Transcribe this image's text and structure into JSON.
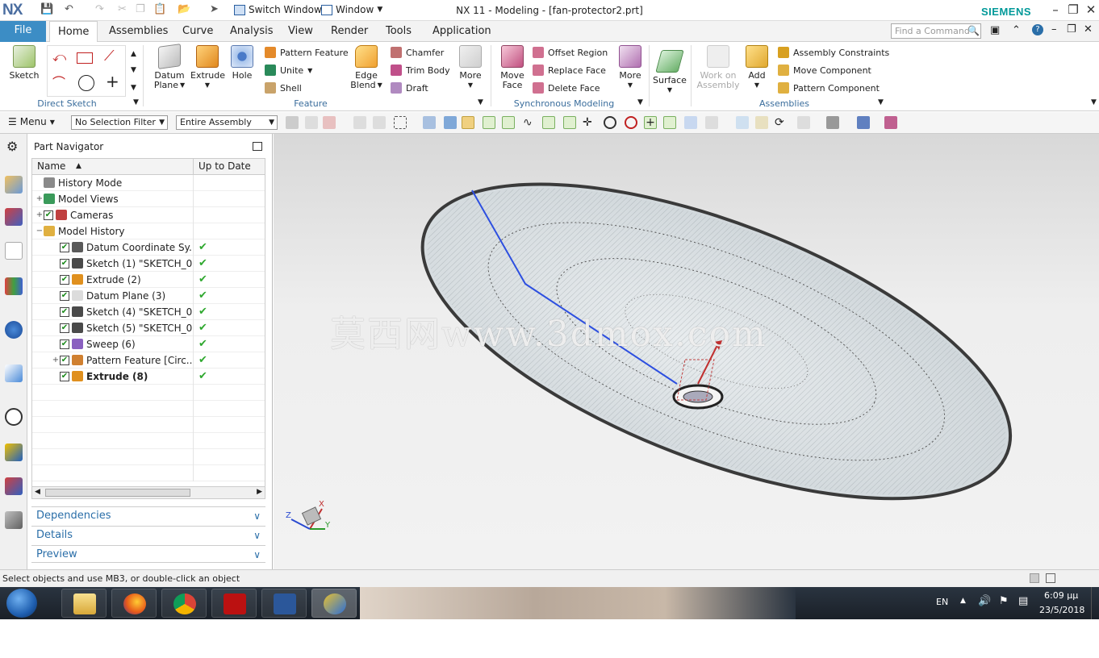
{
  "app": {
    "logo": "NX",
    "window_title": "NX 11 - Modeling - [fan-protector2.prt]",
    "brand": "SIEMENS",
    "switch_window": "Switch Window",
    "window_menu": "Window"
  },
  "tabs": {
    "file": "File",
    "items": [
      "Home",
      "Assemblies",
      "Curve",
      "Analysis",
      "View",
      "Render",
      "Tools",
      "Application"
    ],
    "active": "Home"
  },
  "find_command": {
    "placeholder": "Find a Command"
  },
  "ribbon": {
    "sketch": "Sketch",
    "direct_sketch_label": "Direct Sketch",
    "datum_plane": [
      "Datum",
      "Plane"
    ],
    "extrude": "Extrude",
    "hole": "Hole",
    "pattern_feature": "Pattern Feature",
    "unite": "Unite",
    "shell": "Shell",
    "edge_blend": [
      "Edge",
      "Blend"
    ],
    "chamfer": "Chamfer",
    "trim_body": "Trim Body",
    "draft": "Draft",
    "more1": "More",
    "feature_label": "Feature",
    "move_face": [
      "Move",
      "Face"
    ],
    "offset_region": "Offset Region",
    "replace_face": "Replace Face",
    "delete_face": "Delete Face",
    "more2": "More",
    "sync_label": "Synchronous Modeling",
    "surface": "Surface",
    "work_on_assembly": [
      "Work on",
      "Assembly"
    ],
    "add": "Add",
    "assembly_constraints": "Assembly Constraints",
    "move_component": "Move Component",
    "pattern_component": "Pattern Component",
    "assemblies_label": "Assemblies"
  },
  "toolbar": {
    "menu": "Menu",
    "selection_filter": "No Selection Filter",
    "scope": "Entire Assembly"
  },
  "navigator": {
    "title": "Part Navigator",
    "col_name": "Name",
    "col_uptodate": "Up to Date",
    "rows": [
      {
        "label": "History Mode",
        "level": 0,
        "expander": "",
        "check": false,
        "uptodate": false,
        "bold": false,
        "icon": "clock-icon"
      },
      {
        "label": "Model Views",
        "level": 0,
        "expander": "+",
        "check": false,
        "uptodate": false,
        "bold": false,
        "icon": "views-icon"
      },
      {
        "label": "Cameras",
        "level": 0,
        "expander": "+",
        "check": true,
        "uptodate": false,
        "bold": false,
        "icon": "camera-icon"
      },
      {
        "label": "Model History",
        "level": 0,
        "expander": "−",
        "check": false,
        "uptodate": false,
        "bold": false,
        "icon": "folder-icon"
      },
      {
        "label": "Datum Coordinate Sy...",
        "level": 1,
        "expander": "",
        "check": true,
        "uptodate": true,
        "bold": false,
        "icon": "csys-icon"
      },
      {
        "label": "Sketch (1) \"SKETCH_0...",
        "level": 1,
        "expander": "",
        "check": true,
        "uptodate": true,
        "bold": false,
        "icon": "sketch-icon"
      },
      {
        "label": "Extrude (2)",
        "level": 1,
        "expander": "",
        "check": true,
        "uptodate": true,
        "bold": false,
        "icon": "extrude-icon"
      },
      {
        "label": "Datum Plane (3)",
        "level": 1,
        "expander": "",
        "check": true,
        "uptodate": true,
        "bold": false,
        "icon": "plane-icon"
      },
      {
        "label": "Sketch (4) \"SKETCH_0...",
        "level": 1,
        "expander": "",
        "check": true,
        "uptodate": true,
        "bold": false,
        "icon": "sketch-icon"
      },
      {
        "label": "Sketch (5) \"SKETCH_0...",
        "level": 1,
        "expander": "",
        "check": true,
        "uptodate": true,
        "bold": false,
        "icon": "sketch-icon"
      },
      {
        "label": "Sweep (6)",
        "level": 1,
        "expander": "",
        "check": true,
        "uptodate": true,
        "bold": false,
        "icon": "sweep-icon"
      },
      {
        "label": "Pattern Feature [Circ...",
        "level": 1,
        "expander": "+",
        "check": true,
        "uptodate": true,
        "bold": false,
        "icon": "pattern-icon"
      },
      {
        "label": "Extrude (8)",
        "level": 1,
        "expander": "",
        "check": true,
        "uptodate": true,
        "bold": true,
        "icon": "extrude-icon"
      }
    ],
    "panels": [
      "Dependencies",
      "Details",
      "Preview"
    ]
  },
  "viewport": {
    "watermark": "莫西网www.3dmox.com",
    "axis_labels": [
      "Z",
      "X",
      "Y"
    ]
  },
  "status": {
    "text": "Select objects and use MB3, or double-click an object"
  },
  "taskbar": {
    "lang": "EN",
    "time": "6:09 μμ",
    "date": "23/5/2018"
  }
}
